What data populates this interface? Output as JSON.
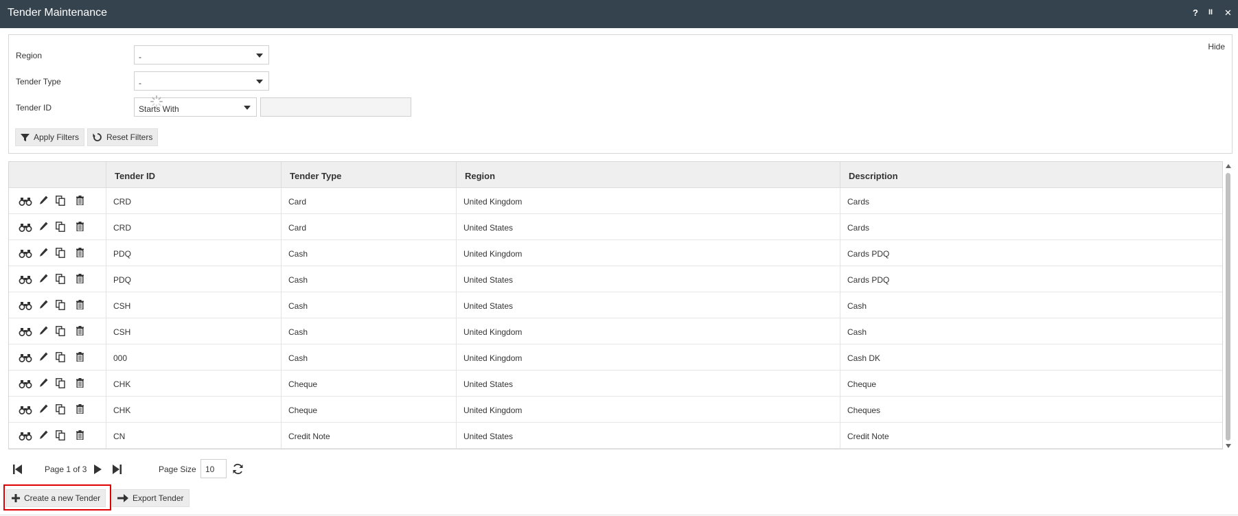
{
  "window": {
    "title": "Tender Maintenance",
    "controls": {
      "help": "?",
      "pause": "II",
      "close": "✕"
    }
  },
  "filters": {
    "hide_label": "Hide",
    "region": {
      "label": "Region",
      "value": "-"
    },
    "tender_type": {
      "label": "Tender Type",
      "value": "-"
    },
    "tender_id": {
      "label": "Tender ID",
      "operator": "Starts With",
      "value": ""
    },
    "apply_label": "Apply Filters",
    "reset_label": "Reset Filters"
  },
  "grid": {
    "columns": [
      "Tender ID",
      "Tender Type",
      "Region",
      "Description"
    ],
    "rows": [
      {
        "tender_id": "CRD",
        "tender_type": "Card",
        "region": "United Kingdom",
        "description": "Cards"
      },
      {
        "tender_id": "CRD",
        "tender_type": "Card",
        "region": "United States",
        "description": "Cards"
      },
      {
        "tender_id": "PDQ",
        "tender_type": "Cash",
        "region": "United Kingdom",
        "description": "Cards PDQ"
      },
      {
        "tender_id": "PDQ",
        "tender_type": "Cash",
        "region": "United States",
        "description": "Cards PDQ"
      },
      {
        "tender_id": "CSH",
        "tender_type": "Cash",
        "region": "United States",
        "description": "Cash"
      },
      {
        "tender_id": "CSH",
        "tender_type": "Cash",
        "region": "United Kingdom",
        "description": "Cash"
      },
      {
        "tender_id": "000",
        "tender_type": "Cash",
        "region": "United Kingdom",
        "description": "Cash DK"
      },
      {
        "tender_id": "CHK",
        "tender_type": "Cheque",
        "region": "United States",
        "description": "Cheque"
      },
      {
        "tender_id": "CHK",
        "tender_type": "Cheque",
        "region": "United Kingdom",
        "description": "Cheques"
      },
      {
        "tender_id": "CN",
        "tender_type": "Credit Note",
        "region": "United States",
        "description": "Credit Note"
      }
    ]
  },
  "pager": {
    "page_info": "Page 1 of 3",
    "page_size_label": "Page Size",
    "page_size": "10"
  },
  "actions": {
    "create_label": "Create a new Tender",
    "export_label": "Export Tender"
  },
  "colors": {
    "titlebar": "#35434f",
    "highlight": "#e00000"
  }
}
